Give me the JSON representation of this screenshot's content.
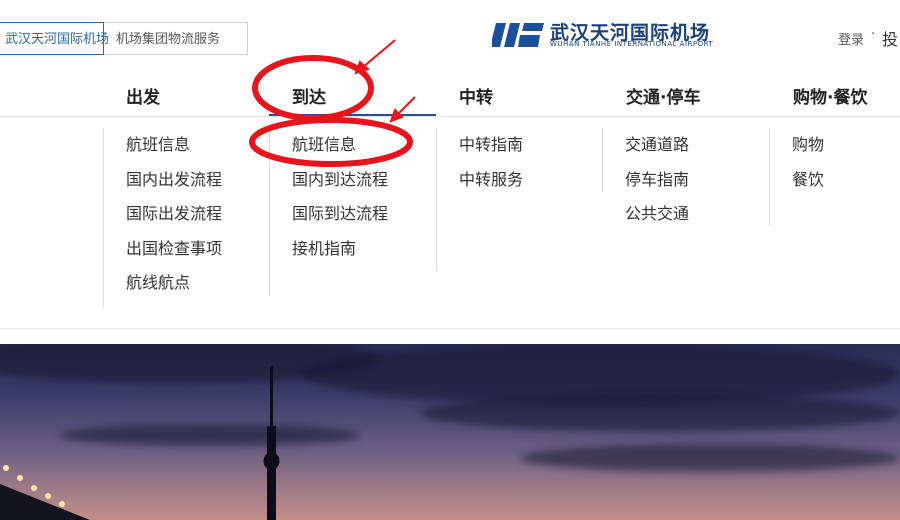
{
  "header": {
    "site_tabs": [
      "武汉天河国际机场",
      "机场集团物流服务"
    ],
    "logo_cn": "武汉天河国际机场",
    "logo_en": "WUHAN TIANHE INTERNATIONAL AIRPORT",
    "login": "登录",
    "separator": "·",
    "cut_text": "投"
  },
  "nav": {
    "items": [
      "出发",
      "到达",
      "中转",
      "交通·停车",
      "购物·餐饮"
    ],
    "active_index": 1
  },
  "menu": {
    "columns": [
      {
        "links": [
          "航班信息",
          "国内出发流程",
          "国际出发流程",
          "出国检查事项",
          "航线航点"
        ]
      },
      {
        "links": [
          "航班信息",
          "国内到达流程",
          "国际到达流程",
          "接机指南"
        ]
      },
      {
        "links": [
          "中转指南",
          "中转服务"
        ]
      },
      {
        "links": [
          "交通道路",
          "停车指南",
          "公共交通"
        ]
      },
      {
        "links": [
          "购物",
          "餐饮"
        ]
      }
    ]
  },
  "colors": {
    "brand": "#1b3f79",
    "annotation": "#e8141c",
    "active_underline": "#2b4f8d"
  }
}
